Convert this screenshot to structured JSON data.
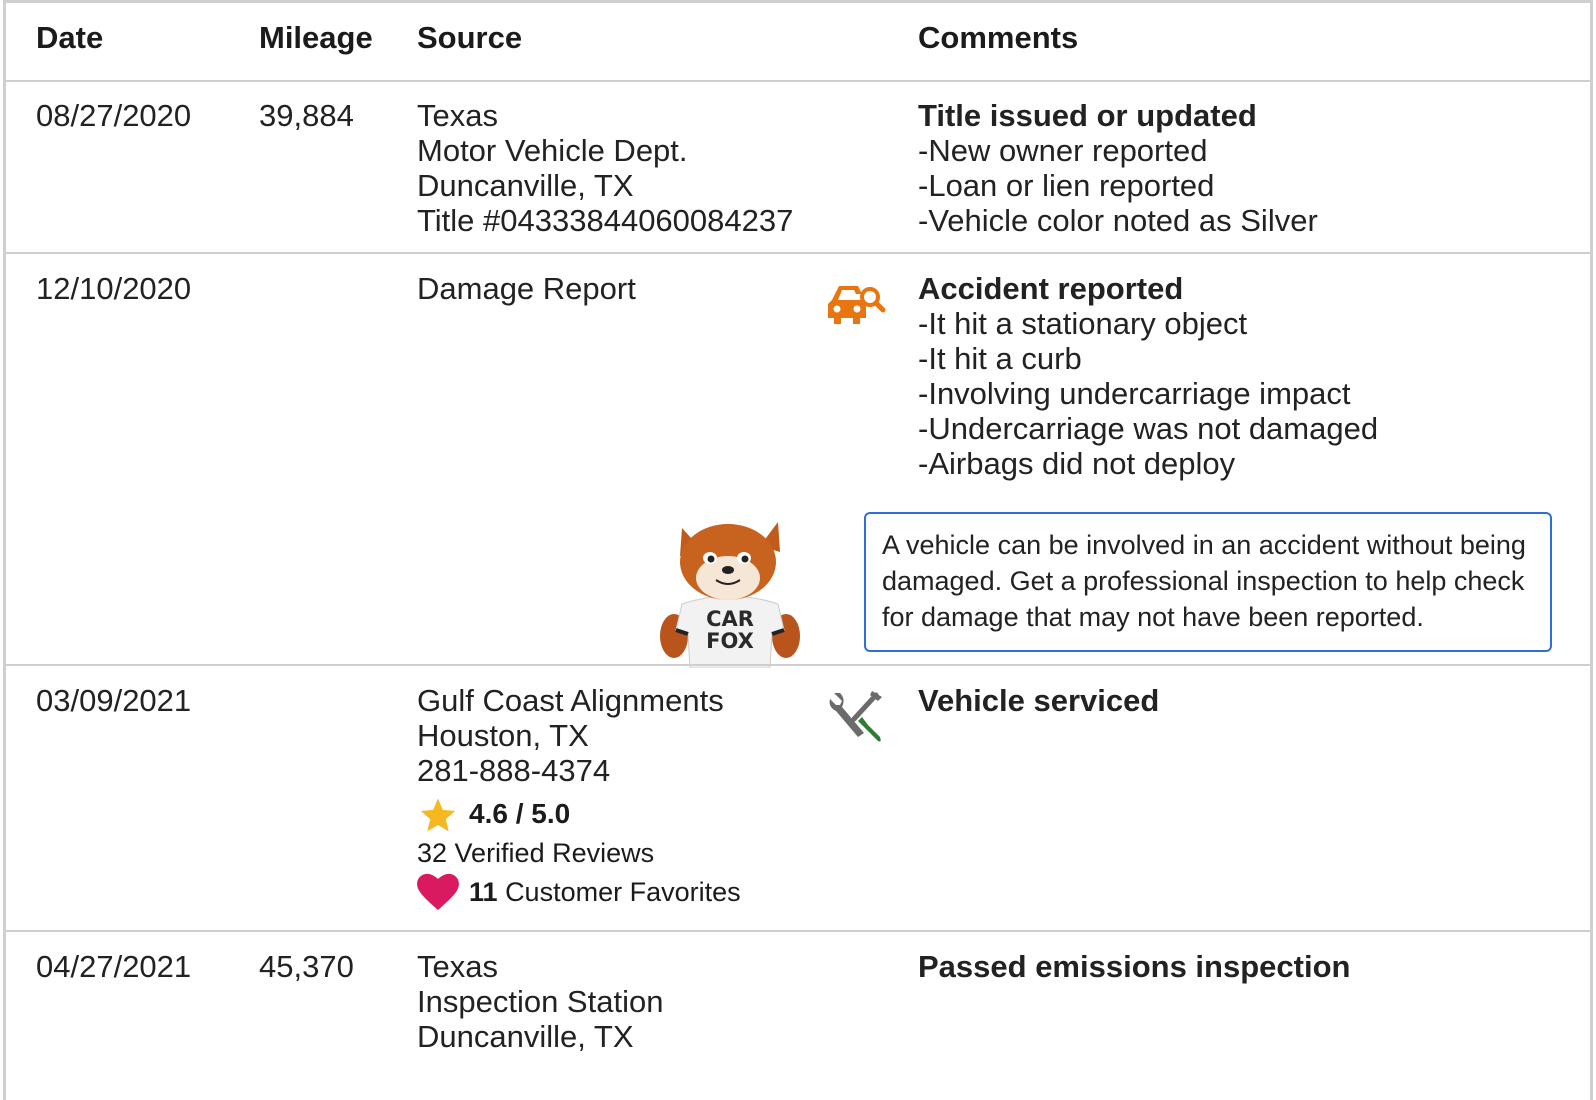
{
  "header": {
    "date": "Date",
    "mileage": "Mileage",
    "source": "Source",
    "comments": "Comments"
  },
  "records": [
    {
      "date": "08/27/2020",
      "mileage": "39,884",
      "source": [
        "Texas",
        "Motor Vehicle Dept.",
        "Duncanville, TX",
        "Title #04333844060084237"
      ],
      "title": "Title issued or updated",
      "details": [
        "New owner reported",
        "Loan or lien reported",
        "Vehicle color noted as Silver"
      ]
    },
    {
      "date": "12/10/2020",
      "mileage": "",
      "source": [
        "Damage Report"
      ],
      "icon": "car-damage-search-icon",
      "title": "Accident reported",
      "details": [
        "It hit a stationary object",
        "It hit a curb",
        "Involving undercarriage impact",
        "Undercarriage was not damaged",
        "Airbags did not deploy"
      ],
      "note": "A vehicle can be involved in an accident without being damaged. Get a professional inspection to help check for damage that may not have been reported.",
      "mascot_text": "CAR FOX"
    },
    {
      "date": "03/09/2021",
      "mileage": "",
      "source": [
        "Gulf Coast Alignments",
        "Houston, TX",
        "281-888-4374"
      ],
      "icon": "wrench-screwdriver-icon",
      "title": "Vehicle serviced",
      "rating": "4.6 / 5.0",
      "reviews": "32 Verified Reviews",
      "favorites_count": "11",
      "favorites_label": "Customer Favorites"
    },
    {
      "date": "04/27/2021",
      "mileage": "45,370",
      "source": [
        "Texas",
        "Inspection Station",
        "Duncanville, TX"
      ],
      "title": "Passed emissions inspection"
    }
  ],
  "colors": {
    "accent_orange": "#e8750f",
    "note_border": "#2f6fd8",
    "star": "#f6b820",
    "heart": "#d91a60",
    "wrench_gray": "#6b6b6b",
    "screwdriver_green": "#2e7d32"
  }
}
